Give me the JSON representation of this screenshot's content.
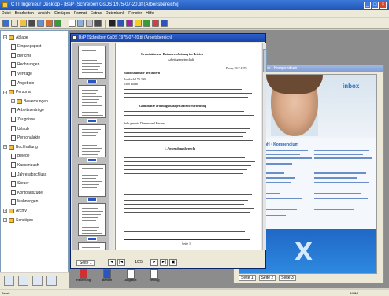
{
  "window": {
    "title": "CTT Ingenieur Desktop - [BsP (Schreiben GsDS 1975-07-20.tif (Arbeitsbereich)]",
    "min": "_",
    "max": "□",
    "close": "×"
  },
  "menu": [
    "Datei",
    "Bearbeiten",
    "Ansicht",
    "Einfügen",
    "Format",
    "Extras",
    "Datenbank",
    "Fenster",
    "Hilfe"
  ],
  "toolbar_icons": [
    "search-icon",
    "new-icon",
    "open-icon",
    "print-icon",
    "scan-icon",
    "tools-icon",
    "help-icon",
    "page-icon",
    "copy-icon",
    "paste-icon",
    "barcode-icon",
    "cursor-icon",
    "pen-icon",
    "text-icon",
    "highlight-icon",
    "check-icon",
    "stamp-icon",
    "question-icon"
  ],
  "tree": [
    {
      "label": "Ablage",
      "level": 0,
      "kind": "folder",
      "expander": "−"
    },
    {
      "label": "Eingangspost",
      "level": 1,
      "kind": "doc"
    },
    {
      "label": "Berichte",
      "level": 1,
      "kind": "doc"
    },
    {
      "label": "Rechnungen",
      "level": 1,
      "kind": "doc"
    },
    {
      "label": "Verträge",
      "level": 1,
      "kind": "doc"
    },
    {
      "label": "Angebote",
      "level": 1,
      "kind": "doc"
    },
    {
      "label": "Personal",
      "level": 0,
      "kind": "folder",
      "expander": "−"
    },
    {
      "label": "Bewerbungen",
      "level": 1,
      "kind": "folder",
      "expander": "+"
    },
    {
      "label": "Arbeitsverträge",
      "level": 1,
      "kind": "doc"
    },
    {
      "label": "Zeugnisse",
      "level": 1,
      "kind": "doc"
    },
    {
      "label": "Urlaub",
      "level": 1,
      "kind": "doc"
    },
    {
      "label": "Personalakte",
      "level": 1,
      "kind": "doc"
    },
    {
      "label": "Buchhaltung",
      "level": 0,
      "kind": "folder",
      "expander": "−"
    },
    {
      "label": "Belege",
      "level": 1,
      "kind": "doc"
    },
    {
      "label": "Kassenbuch",
      "level": 1,
      "kind": "doc"
    },
    {
      "label": "Jahresabschluss",
      "level": 1,
      "kind": "doc"
    },
    {
      "label": "Steuer",
      "level": 1,
      "kind": "doc"
    },
    {
      "label": "Kontoauszüge",
      "level": 1,
      "kind": "doc"
    },
    {
      "label": "Mahnungen",
      "level": 1,
      "kind": "doc"
    },
    {
      "label": "Archiv",
      "level": 0,
      "kind": "folder",
      "expander": "+"
    },
    {
      "label": "Sonstiges",
      "level": 0,
      "kind": "folder",
      "expander": "+"
    }
  ],
  "doc1": {
    "title": "BsP (Schreiben GsDS 1975-07-20.tif (Arbeitsbereich)",
    "tab": "Seite 1",
    "page_info": "1/25",
    "letter": {
      "heading1": "Grundsätze zur Datenverarbeitung im Betrieb",
      "heading2": "Arbeitsgemeinschaft",
      "date": "Bonn, 20.7.1975",
      "addr1": "Bundesminister des Innern",
      "addr2": "Postfach 170 290",
      "addr3": "5300 Bonn 7",
      "subject": "Grundsätze ordnungsmäßiger Datenverarbeitung",
      "salutation": "Sehr geehrte Damen und Herren,",
      "section": "I. Anwendungsbereich",
      "footer": "Seite 1"
    }
  },
  "doc2": {
    "title": "Broschüre Inbox - Kompendium",
    "brand": "inbox",
    "heading": "Lorem GmbH · Kompendium",
    "mark": "X",
    "tabs": [
      "Seite 1",
      "Seite 2",
      "Seite 3"
    ]
  },
  "files": [
    {
      "label": "Rechnung",
      "icon": "pdf-icon"
    },
    {
      "label": "Bericht",
      "icon": "word-icon"
    },
    {
      "label": "Angebot",
      "icon": "doc-icon"
    },
    {
      "label": "Vertrag",
      "icon": "doc-icon"
    }
  ],
  "status": {
    "left": "Bereit",
    "right": "NUM"
  }
}
